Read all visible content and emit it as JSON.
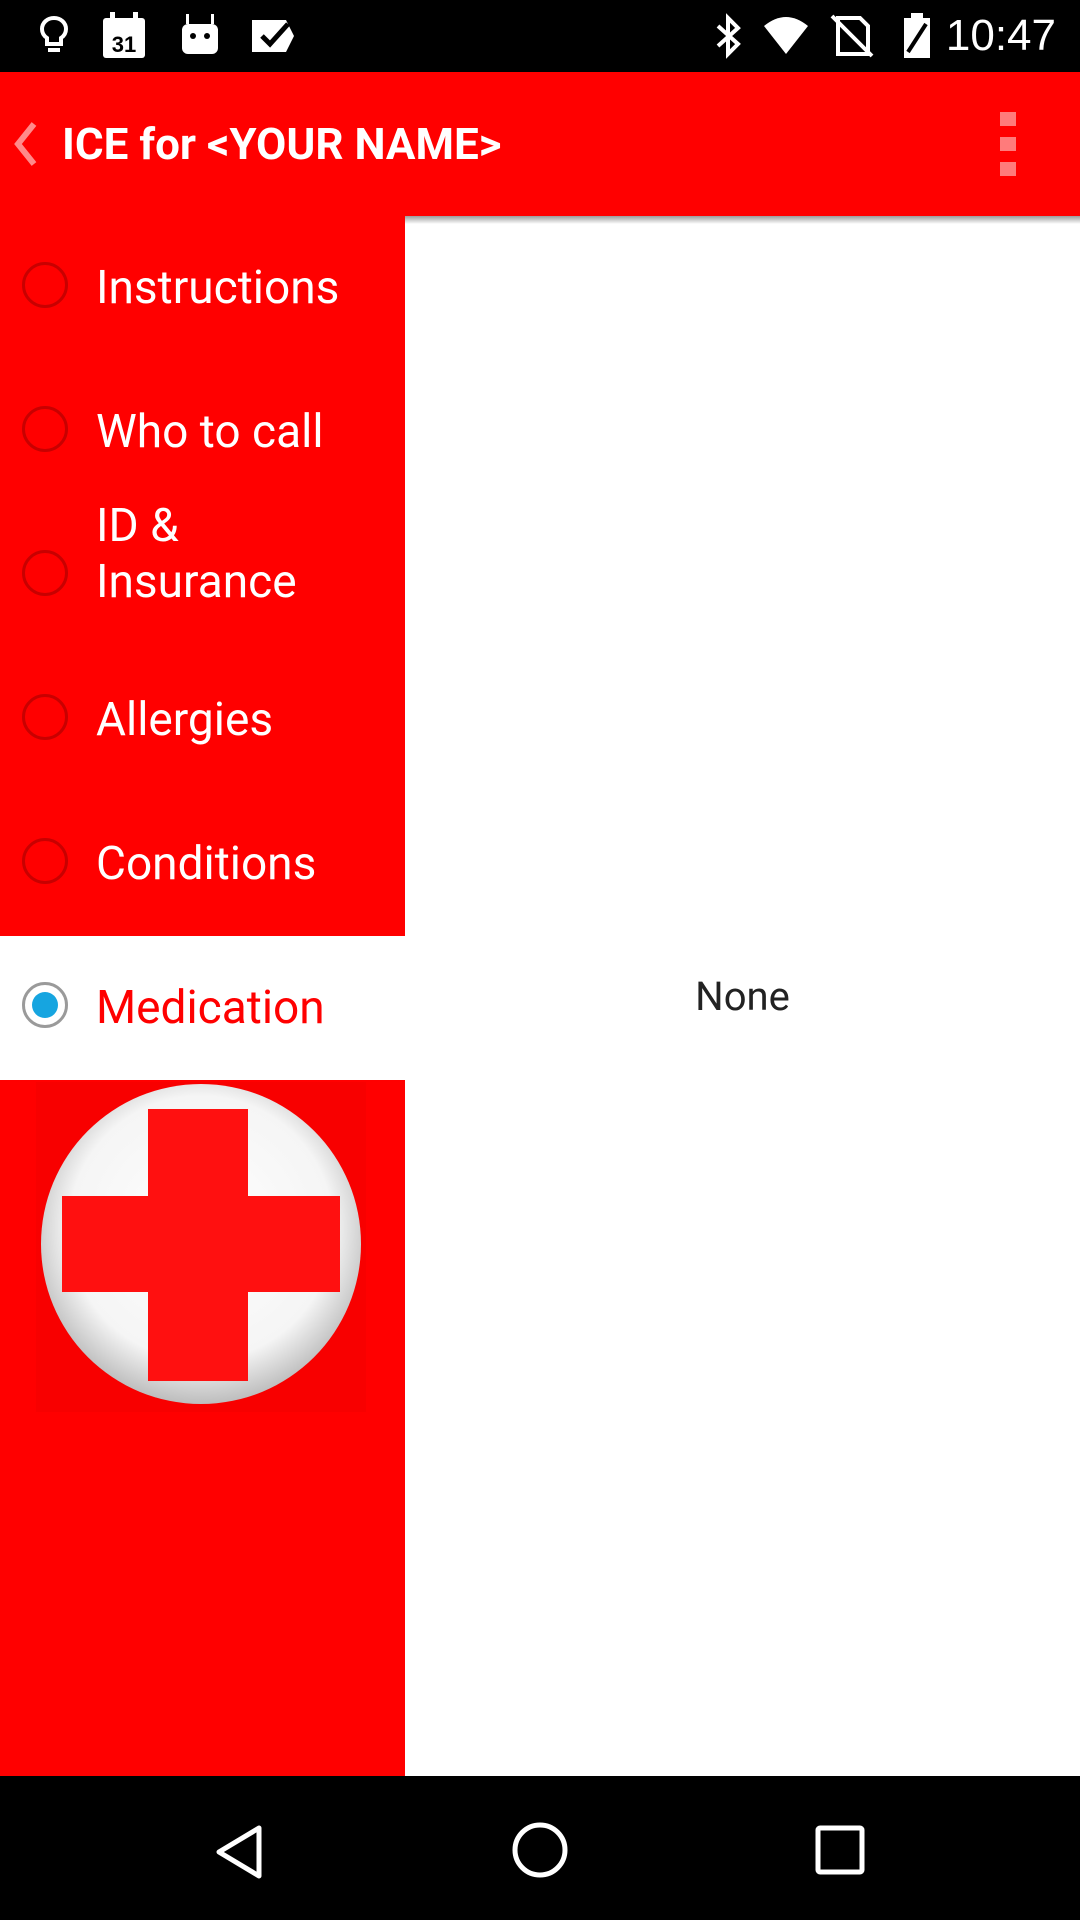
{
  "status_bar": {
    "time": "10:47",
    "left_icons": [
      "lightbulb-icon",
      "calendar-icon",
      "android-icon",
      "check-icon"
    ],
    "calendar_day": "31",
    "right_icons": [
      "bluetooth-icon",
      "wifi-icon",
      "no-sim-icon",
      "battery-icon"
    ]
  },
  "app_bar": {
    "title": "ICE for <YOUR NAME>",
    "background": "#ff0000"
  },
  "sidebar": {
    "items": [
      {
        "label": "Instructions",
        "selected": false
      },
      {
        "label": "Who to call",
        "selected": false
      },
      {
        "label": "ID & Insurance",
        "selected": false
      },
      {
        "label": "Allergies",
        "selected": false
      },
      {
        "label": "Conditions",
        "selected": false
      },
      {
        "label": "Medication",
        "selected": true
      }
    ],
    "logo": "red-cross-logo"
  },
  "content": {
    "value": "None"
  },
  "nav_bar": {
    "buttons": [
      "back-icon",
      "home-icon",
      "recents-icon"
    ]
  },
  "colors": {
    "accent": "#ff0000",
    "selected_radio": "#16a5e0"
  }
}
